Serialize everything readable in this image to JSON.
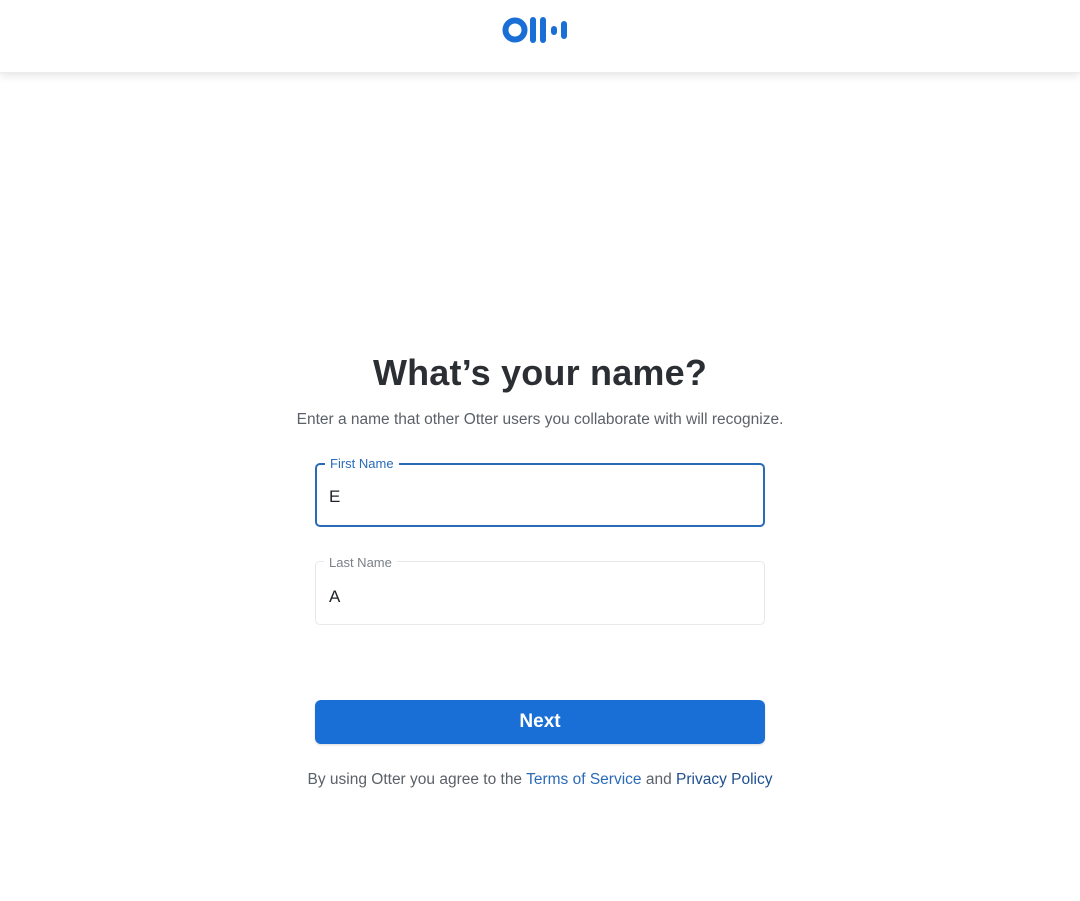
{
  "brand": {
    "logo_icon": "otter-logo-icon",
    "accent_color": "#1a6fd6"
  },
  "page": {
    "title": "What’s your name?",
    "subtitle": "Enter a name that other Otter users you collaborate with will recognize."
  },
  "form": {
    "first_name": {
      "label": "First Name",
      "value": "E"
    },
    "last_name": {
      "label": "Last Name",
      "value": "A"
    },
    "next_label": "Next"
  },
  "legal": {
    "prefix": "By using Otter you agree to the ",
    "terms_label": "Terms of Service",
    "conjunction": " and ",
    "privacy_label": "Privacy Policy"
  }
}
